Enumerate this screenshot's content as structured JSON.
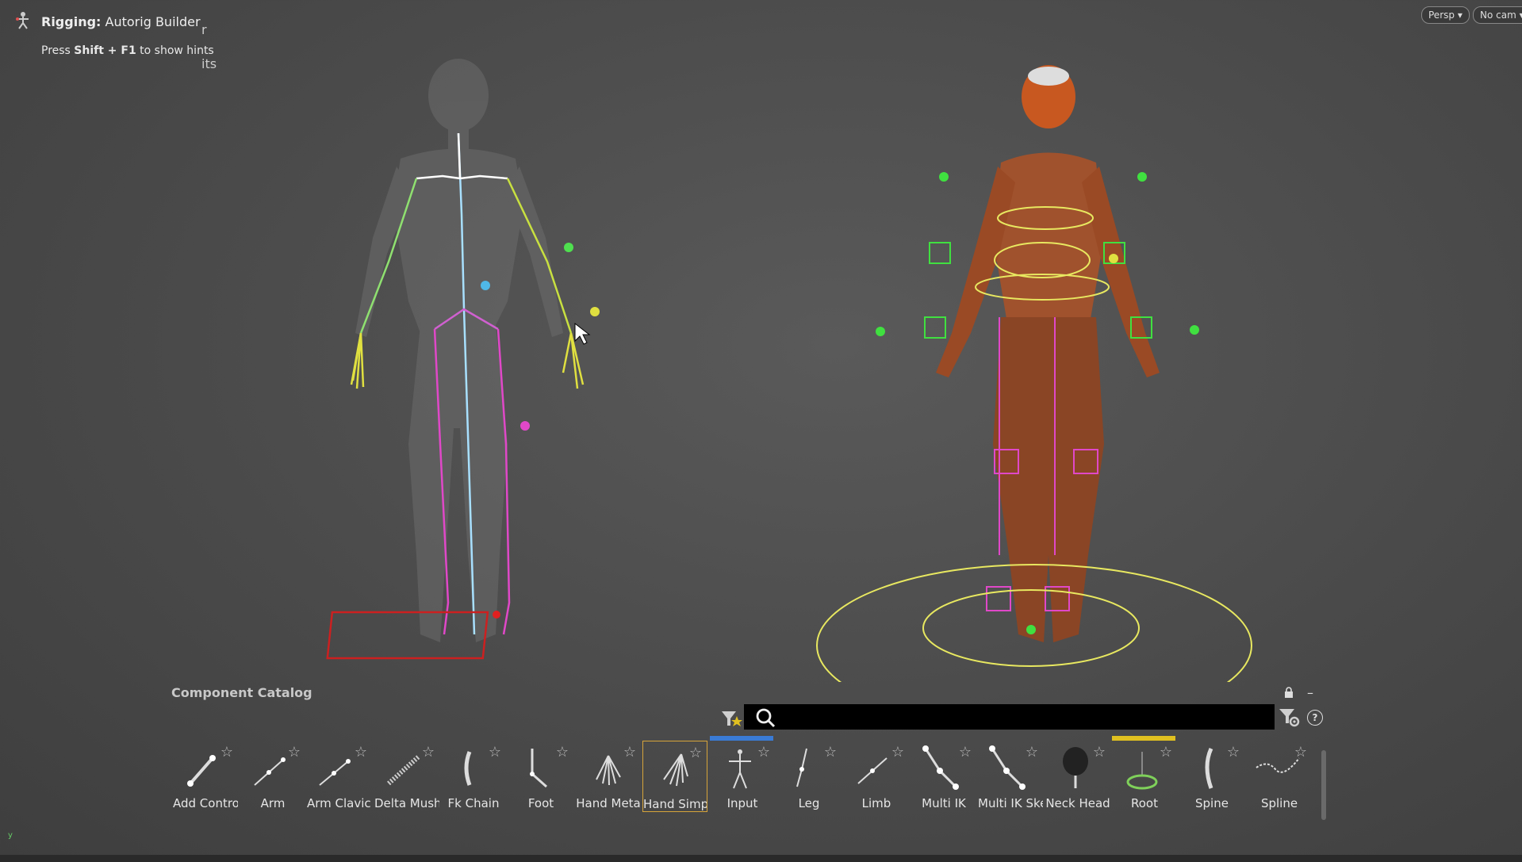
{
  "hud": {
    "title_prefix": "Rigging:",
    "title_mode": "Autorig Builder",
    "hint_prefix": "Press ",
    "hint_keys": "Shift + F1",
    "hint_suffix": " to show hints",
    "ghost_text_1": "r",
    "ghost_text_2": "its"
  },
  "viewport": {
    "camera_view": "Persp",
    "camera_select": "No cam",
    "accent_colors": {
      "spine": "#4fb8e8",
      "arm_left": "#6fd060",
      "arm_right": "#c8e040",
      "leg": "#e048c8",
      "hand": "#e0e040",
      "root": "#e04040",
      "ring": "#e8e860"
    }
  },
  "catalog": {
    "title": "Component Catalog",
    "search_placeholder": "",
    "items": [
      {
        "label": "Add Control",
        "icon": "add-control-icon"
      },
      {
        "label": "Arm",
        "icon": "arm-icon"
      },
      {
        "label": "Arm Clavicle",
        "icon": "arm-clavicle-icon"
      },
      {
        "label": "Delta Mush",
        "icon": "delta-mush-icon"
      },
      {
        "label": "Fk Chain",
        "icon": "fk-chain-icon"
      },
      {
        "label": "Foot",
        "icon": "foot-icon"
      },
      {
        "label": "Hand Meta",
        "icon": "hand-meta-icon"
      },
      {
        "label": "Hand Simple",
        "icon": "hand-simple-icon",
        "selected": true
      },
      {
        "label": "Input",
        "icon": "input-icon",
        "bar": "#3a7bd5"
      },
      {
        "label": "Leg",
        "icon": "leg-icon"
      },
      {
        "label": "Limb",
        "icon": "limb-icon"
      },
      {
        "label": "Multi IK",
        "icon": "multi-ik-icon"
      },
      {
        "label": "Multi IK Skel",
        "icon": "multi-ik-skel-icon"
      },
      {
        "label": "Neck Head",
        "icon": "neck-head-icon"
      },
      {
        "label": "Root",
        "icon": "root-icon",
        "bar": "#e0c020"
      },
      {
        "label": "Spine",
        "icon": "spine-icon"
      },
      {
        "label": "Spline",
        "icon": "spline-icon"
      }
    ]
  },
  "axis": {
    "y": "y"
  }
}
